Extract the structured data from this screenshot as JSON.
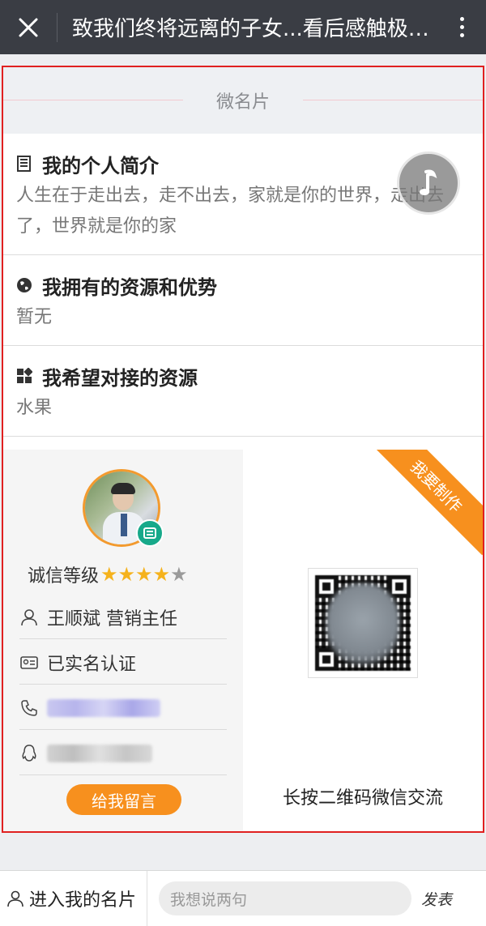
{
  "topbar": {
    "title": "致我们终将远离的子女...看后感触极深！"
  },
  "card": {
    "section_title": "微名片",
    "intro": {
      "heading": "我的个人简介",
      "text": "人生在于走出去，走不出去，家就是你的世界，走出去了，世界就是你的家"
    },
    "resources": {
      "heading": "我拥有的资源和优势",
      "text": "暂无"
    },
    "wanted": {
      "heading": "我希望对接的资源",
      "text": "水果"
    },
    "profile": {
      "credit_label": "诚信等级",
      "stars": 4.5,
      "name_title": "王顺斌 营销主任",
      "verified": "已实名认证",
      "message_button": "给我留言"
    },
    "ribbon": "我要制作",
    "qr_caption": "长按二维码微信交流"
  },
  "bottom": {
    "enter_card": "进入我的名片",
    "comment_placeholder": "我想说两句",
    "send": "发表"
  },
  "colors": {
    "accent": "#f7901e",
    "frame": "#e02020",
    "topbar": "#3a3d44"
  }
}
